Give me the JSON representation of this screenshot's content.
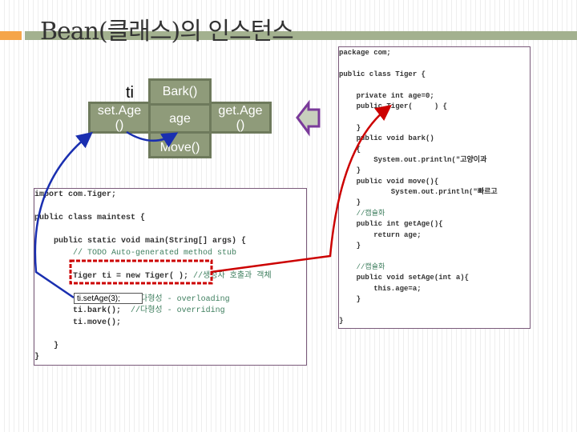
{
  "title": "Bean(클래스)의 인스턴스",
  "diagram": {
    "instance_label": "ti",
    "bark": "Bark()",
    "age": "age",
    "move": "Move()",
    "set_age": "set.Age\n()",
    "get_age": "get.Age\n()"
  },
  "tiger_code": [
    "package com;",
    "",
    "public class Tiger {",
    "",
    "    private int age=0;",
    "    public Tiger(     ) {",
    "",
    "    }",
    "    public void bark()",
    "    {",
    "        System.out.println(\"고양이과",
    "    }",
    "    public void move(){",
    "            System.out.println(\"빠르고",
    "    }",
    "    //캡슐화",
    "    public int getAge(){",
    "        return age;",
    "    }",
    "",
    "    //캡슐화",
    "    public void setAge(int a){",
    "        this.age=a;",
    "    }",
    "",
    "}"
  ],
  "main_code": [
    "import com.Tiger;",
    "",
    "public class maintest {",
    "",
    "    public static void main(String[] args) {",
    "        // TODO Auto-generated method stub",
    "",
    "        Tiger ti = new Tiger( ); //생성자 호출과 객체",
    "",
    "        ti.bark(3); //다형성 - overloading",
    "        ti.bark();  //다형성 - overriding",
    "        ti.move();",
    "",
    "    }",
    "}"
  ],
  "callout": "ti.setAge(3);",
  "colors": {
    "box": "#8f9b7a",
    "accent_orange": "#f5a54a",
    "title_bar": "#a3b18f",
    "arrow_blue": "#1a2fb0",
    "arrow_red": "#cc0000",
    "left_arrow": "#7a3a9a"
  }
}
